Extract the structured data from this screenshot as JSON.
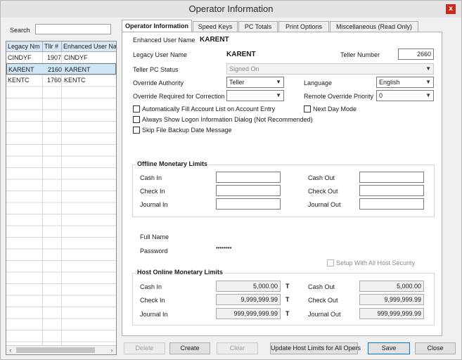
{
  "window": {
    "title": "Operator Information",
    "close_label": "x"
  },
  "left": {
    "search_label": "Search",
    "search_value": "",
    "grid": {
      "columns": [
        "Legacy Nm",
        "Tllr #",
        "Enhanced User Na"
      ],
      "rows": [
        [
          "CINDYF",
          "1907",
          "CINDYF"
        ],
        [
          "KARENT",
          "2160",
          "KARENT"
        ],
        [
          "KENTC",
          "1760",
          "KENTC"
        ]
      ]
    },
    "scroll_left": "‹",
    "scroll_right": "›"
  },
  "tabs": [
    "Operator Information",
    "Speed Keys",
    "PC Totals",
    "Print Options",
    "Miscellaneous (Read Only)"
  ],
  "form": {
    "enhanced_user_label": "Enhanced User Name",
    "enhanced_user_value": "KARENT",
    "legacy_user_label": "Legacy User Name",
    "legacy_user_value": "KARENT",
    "teller_number_label": "Teller Number",
    "teller_number_value": "2660",
    "teller_pc_status_label": "Teller PC Status",
    "teller_pc_status_value": "Signed On",
    "override_authority_label": "Override Authority",
    "override_authority_value": "Teller",
    "language_label": "Language",
    "language_value": "English",
    "override_required_label": "Override Required for Correction",
    "override_required_value": "",
    "remote_override_label": "Remote Override Priority",
    "remote_override_value": "0",
    "cb_autofill": "Automatically Fill Account List on Account Entry",
    "cb_next_day": "Next Day Mode",
    "cb_logon_dialog": "Always Show Logon Information Dialog (Not Recommended)",
    "cb_skip_backup": "Skip File Backup Date Message"
  },
  "offline": {
    "title": "Offline Monetary Limits",
    "cash_in": "Cash In",
    "check_in": "Check In",
    "journal_in": "Journal In",
    "cash_out": "Cash Out",
    "check_out": "Check Out",
    "journal_out": "Journal Out",
    "cash_in_value": "",
    "check_in_value": "",
    "journal_in_value": "",
    "cash_out_value": "",
    "check_out_value": "",
    "journal_out_value": ""
  },
  "account": {
    "full_name_label": "Full Name",
    "password_label": "Password",
    "password_value": "••••••••",
    "setup_host_security": "Setup With All Host Security"
  },
  "host": {
    "title": "Host Online Monetary Limits",
    "cash_in": "Cash In",
    "check_in": "Check In",
    "journal_in": "Journal In",
    "cash_out": "Cash Out",
    "check_out": "Check Out",
    "journal_out": "Journal Out",
    "cash_in_value": "5,000.00",
    "check_in_value": "9,999,999.99",
    "journal_in_value": "999,999,999.99",
    "cash_out_value": "5,000.00",
    "check_out_value": "9,999,999.99",
    "journal_out_value": "999,999,999.99",
    "t_mark": "T"
  },
  "buttons": {
    "delete": "Delete",
    "create": "Create",
    "clear": "Clear",
    "update_host": "Update Host Limits for All Opers",
    "save": "Save",
    "close": "Close"
  }
}
